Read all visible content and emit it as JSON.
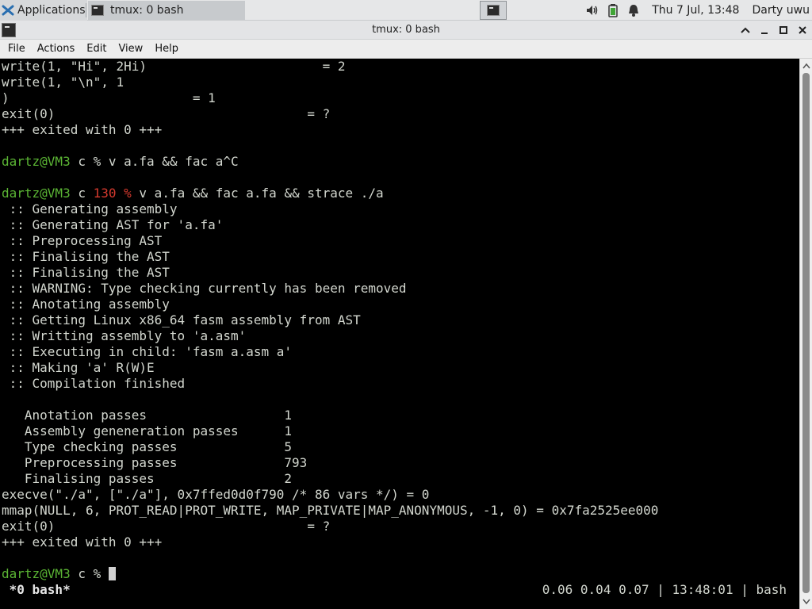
{
  "panel": {
    "applications_label": "Applications",
    "task_label": "tmux: 0 bash",
    "clock": "Thu  7 Jul, 13:48",
    "user": "Darty uwu",
    "icons": [
      "xfce-logo-icon",
      "terminal-icon",
      "workspace-terminal-icon",
      "volume-icon",
      "battery-icon",
      "notification-bell-icon"
    ]
  },
  "window": {
    "title": "tmux: 0 bash",
    "buttons": [
      "minimize-up-icon",
      "minimize-icon",
      "maximize-icon",
      "close-icon"
    ]
  },
  "menu": {
    "file": "File",
    "actions": "Actions",
    "edit": "Edit",
    "view": "View",
    "help": "Help"
  },
  "terminal": {
    "l1": "write(1, \"Hi\", 2Hi)                       = 2",
    "l2": "write(1, \"\\n\", 1",
    "l3": ")                        = 1",
    "l4": "exit(0)                                 = ?",
    "l5": "+++ exited with 0 +++",
    "l7_prompt_user": "dartz@VM3",
    "l7_prompt_dir": " c % ",
    "l7_cmd": "v a.fa && fac a^C",
    "l9_prompt_user": "dartz@VM3",
    "l9_prompt_dir": " c ",
    "l9_status": "130 %",
    "l9_cmd": " v a.fa && fac a.fa && strace ./a",
    "l10": " :: Generating assembly",
    "l11": " :: Generating AST for 'a.fa'",
    "l12": " :: Preprocessing AST",
    "l13": " :: Finalising the AST",
    "l14": " :: Finalising the AST",
    "l15": " :: WARNING: Type checking currently has been removed",
    "l16": " :: Anotating assembly",
    "l17": " :: Getting Linux x86_64 fasm assembly from AST",
    "l18": " :: Writting assembly to 'a.asm'",
    "l19": " :: Executing in child: 'fasm a.asm a'",
    "l20": " :: Making 'a' R(W)E",
    "l21": " :: Compilation finished",
    "l23": "   Anotation passes                  1",
    "l24": "   Assembly geneneration passes      1",
    "l25": "   Type checking passes              5",
    "l26": "   Preprocessing passes              793",
    "l27": "   Finalising passes                 2",
    "l28": "execve(\"./a\", [\"./a\"], 0x7ffed0d0f790 /* 86 vars */) = 0",
    "l29": "mmap(NULL, 6, PROT_READ|PROT_WRITE, MAP_PRIVATE|MAP_ANONYMOUS, -1, 0) = 0x7fa2525ee000",
    "l30": "exit(0)                                 = ?",
    "l31": "+++ exited with 0 +++",
    "l33_prompt_user": "dartz@VM3",
    "l33_prompt_dir": " c % "
  },
  "tmux_status": {
    "window": " *0 bash*",
    "right": "0.06 0.04 0.07 | 13:48:01 | bash"
  },
  "colors": {
    "prompt": "#5bb534",
    "error_status": "#d53a2e",
    "text": "#d3d7cf"
  }
}
